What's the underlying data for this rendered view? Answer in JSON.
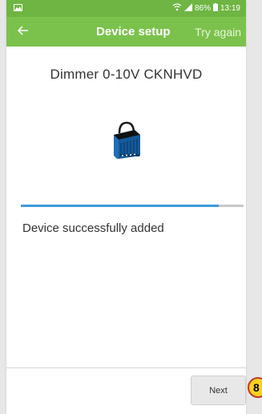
{
  "status_bar": {
    "signal_icon": "wifi-signal-icon",
    "battery": "86%",
    "time": "13:19"
  },
  "app_bar": {
    "title": "Device setup",
    "action": "Try again",
    "back_icon": "arrow-left-icon"
  },
  "device": {
    "name": "Dimmer 0-10V CKNHVD",
    "image_icon": "dimmer-module-icon"
  },
  "progress": {
    "fraction": 0.89
  },
  "status_message": "Device successfully added",
  "footer": {
    "next_label": "Next"
  },
  "annotation": {
    "step_number": "8"
  },
  "colors": {
    "status_bar": "#6fb543",
    "app_bar": "#7bc24c",
    "progress": "#3d9bd8",
    "badge": "#ffd21f"
  }
}
